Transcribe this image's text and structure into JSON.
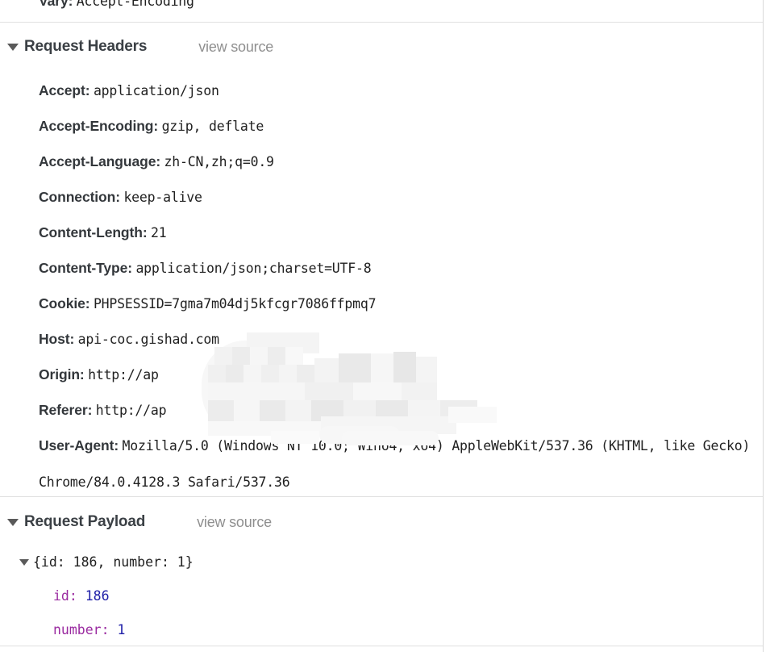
{
  "panel": {
    "clipped_row": {
      "name": "Vary:",
      "value": "Accept-Encoding"
    },
    "sections": {
      "request_headers": {
        "title": "Request Headers",
        "view_source_label": "view source",
        "expanded": true,
        "disclosure_icon": "triangle-down-icon"
      },
      "request_payload": {
        "title": "Request Payload",
        "view_source_label": "view source",
        "expanded": true,
        "disclosure_icon": "triangle-down-icon"
      }
    },
    "request_headers": [
      {
        "name": "Accept:",
        "value": "application/json"
      },
      {
        "name": "Accept-Encoding:",
        "value": "gzip, deflate"
      },
      {
        "name": "Accept-Language:",
        "value": "zh-CN,zh;q=0.9"
      },
      {
        "name": "Connection:",
        "value": "keep-alive"
      },
      {
        "name": "Content-Length:",
        "value": "21"
      },
      {
        "name": "Content-Type:",
        "value": "application/json;charset=UTF-8"
      },
      {
        "name": "Cookie:",
        "value": "PHPSESSID=7gma7m04dj5kfcgr7086ffpmq7"
      },
      {
        "name": "Host:",
        "value": "api-coc.gishad.com"
      },
      {
        "name": "Origin:",
        "value": "http://ap"
      },
      {
        "name": "Referer:",
        "value": "http://ap"
      },
      {
        "name": "User-Agent:",
        "value": "Mozilla/5.0 (Windows NT 10.0; Win64; x64) AppleWebKit/537.36 (KHTML, like Gecko) Chrome/84.0.4128.3 Safari/537.36"
      }
    ],
    "request_payload": {
      "root_summary": "{id: 186, number: 1}",
      "entries": [
        {
          "key": "id",
          "separator": ": ",
          "value": "186"
        },
        {
          "key": "number",
          "separator": ": ",
          "value": "1"
        }
      ]
    },
    "colors": {
      "background": "#ffffff",
      "header_name": "#33373b",
      "header_value": "#212121",
      "section_title": "#3b4045",
      "view_source": "#8f8f8f",
      "separator": "#e0e0e0",
      "json_key": "#9a2aa0",
      "json_value": "#2020a8",
      "redaction_block": "#ededed"
    }
  }
}
